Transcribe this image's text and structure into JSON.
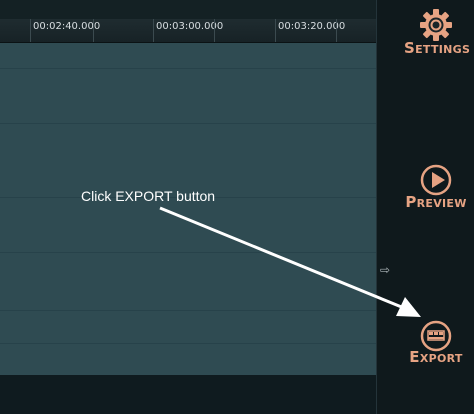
{
  "ruler": {
    "labels": [
      "00:02:40.000",
      "00:03:00.000",
      "00:03:20.000"
    ]
  },
  "sidebar": {
    "settings": {
      "first": "S",
      "rest": "ETTINGS",
      "icon": "gear-icon"
    },
    "preview": {
      "first": "P",
      "rest": "REVIEW",
      "icon": "play-icon"
    },
    "export": {
      "first": "E",
      "rest": "XPORT",
      "icon": "film-icon"
    }
  },
  "side_arrow_glyph": "⇨",
  "annotation": {
    "text": "Click EXPORT button"
  },
  "colors": {
    "accent": "#e6a383",
    "track": "#2f4b52",
    "background": "#0f191c"
  }
}
